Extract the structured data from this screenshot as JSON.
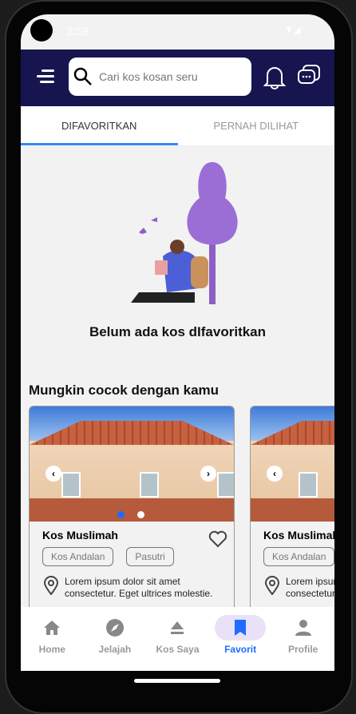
{
  "status": {
    "time": "2:58"
  },
  "header": {
    "search_placeholder": "Cari kos kosan seru"
  },
  "tabs": [
    {
      "label": "DIFAVORITKAN",
      "active": true
    },
    {
      "label": "PERNAH DILIHAT",
      "active": false
    }
  ],
  "empty_message": "Belum ada kos dIfavoritkan",
  "section_title": "Mungkin cocok dengan kamu",
  "cards": [
    {
      "title": "Kos Muslimah",
      "tags": [
        "Kos Andalan",
        "Pasutri"
      ],
      "address": "Lorem ipsum dolor sit amet consectetur. Eget ultrices molestie.",
      "image_index": 0,
      "image_count": 2
    },
    {
      "title": "Kos Muslimah",
      "tags": [
        "Kos Andalan"
      ],
      "address": "Lorem ipsum dolor sit amet consectetur. Eget ultrices molestie."
    }
  ],
  "nav": [
    {
      "label": "Home",
      "icon": "home-icon"
    },
    {
      "label": "Jelajah",
      "icon": "compass-icon"
    },
    {
      "label": "Kos Saya",
      "icon": "eject-icon"
    },
    {
      "label": "Favorit",
      "icon": "bookmark-icon",
      "active": true
    },
    {
      "label": "Profile",
      "icon": "person-icon"
    }
  ],
  "colors": {
    "header": "#16154f",
    "accent": "#1f6cff",
    "tab_indicator": "#2f8cff"
  }
}
